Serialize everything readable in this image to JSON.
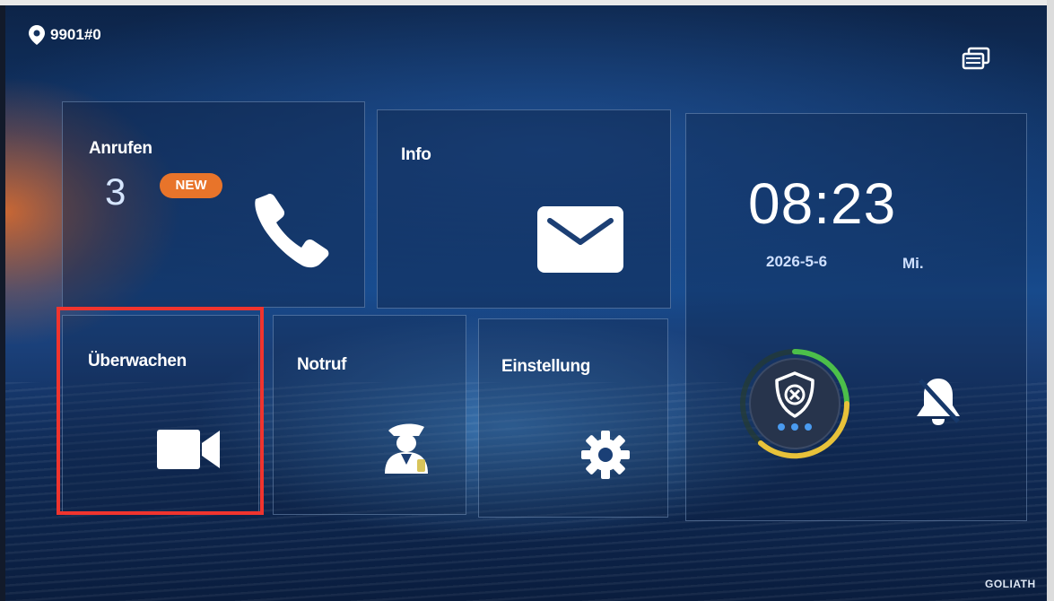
{
  "statusbar": {
    "location": "9901#0",
    "location_icon": "map-pin-icon",
    "display_icon": "display-stack-icon"
  },
  "tiles": {
    "anrufen": {
      "label": "Anrufen",
      "count": "3",
      "badge": "NEW",
      "icon": "phone-icon"
    },
    "info": {
      "label": "Info",
      "icon": "envelope-icon"
    },
    "ueberwachen": {
      "label": "Überwachen",
      "icon": "video-camera-icon",
      "highlighted": true
    },
    "notruf": {
      "label": "Notruf",
      "icon": "guard-icon"
    },
    "einstellung": {
      "label": "Einstellung",
      "icon": "gear-icon"
    }
  },
  "clock": {
    "time": "08:23",
    "date": "2026-5-6",
    "weekday": "Mi."
  },
  "security": {
    "icon": "shield-x-icon",
    "bell_icon": "bell-muted-icon"
  },
  "brand": "GOLIATH",
  "colors": {
    "badge": "#e8742a",
    "highlight": "#f0342e",
    "ring_green": "#4cbf4a",
    "ring_yellow": "#e8c23a"
  }
}
